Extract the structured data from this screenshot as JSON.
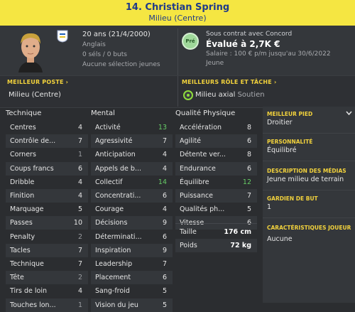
{
  "header": {
    "title": "14. Christian Spring",
    "subtitle": "Milieu (Centre)"
  },
  "player": {
    "age_birth": "20 ans (21/4/2000)",
    "nationality": "Anglais",
    "caps_goals": "0 séls / 0 buts",
    "youth_selection": "Aucune sélection jeunes"
  },
  "contract": {
    "club_text": "Sous contrat avec Concord",
    "value": "Évalué à 2,7K €",
    "salary": "Salaire : 100 € p/m jusqu'au 30/6/2022",
    "status": "Jeune",
    "badge": "Pré"
  },
  "best_position": {
    "label": "MEILLEUR POSTE",
    "value": "Milieu (Centre)"
  },
  "best_role": {
    "label": "MEILLEURS RÔLE ET TÂCHE",
    "role": "Milieu axial",
    "duty": "Soutien"
  },
  "columns": {
    "technique": "Technique",
    "mental": "Mental",
    "physical": "Qualité Physique"
  },
  "technique": [
    {
      "name": "Centres",
      "value": "4"
    },
    {
      "name": "Contrôle de...",
      "value": "7"
    },
    {
      "name": "Corners",
      "value": "1"
    },
    {
      "name": "Coups francs",
      "value": "6"
    },
    {
      "name": "Dribble",
      "value": "4"
    },
    {
      "name": "Finition",
      "value": "4"
    },
    {
      "name": "Marquage",
      "value": "5"
    },
    {
      "name": "Passes",
      "value": "10"
    },
    {
      "name": "Penalty",
      "value": "2"
    },
    {
      "name": "Tacles",
      "value": "7"
    },
    {
      "name": "Technique",
      "value": "7"
    },
    {
      "name": "Tête",
      "value": "2"
    },
    {
      "name": "Tirs de loin",
      "value": "4"
    },
    {
      "name": "Touches lon...",
      "value": "1"
    }
  ],
  "mental": [
    {
      "name": "Activité",
      "value": "13"
    },
    {
      "name": "Agressivité",
      "value": "7"
    },
    {
      "name": "Anticipation",
      "value": "4"
    },
    {
      "name": "Appels de b...",
      "value": "4"
    },
    {
      "name": "Collectif",
      "value": "14"
    },
    {
      "name": "Concentrati...",
      "value": "6"
    },
    {
      "name": "Courage",
      "value": "4"
    },
    {
      "name": "Décisions",
      "value": "9"
    },
    {
      "name": "Déterminati...",
      "value": "6"
    },
    {
      "name": "Inspiration",
      "value": "9"
    },
    {
      "name": "Leadership",
      "value": "7"
    },
    {
      "name": "Placement",
      "value": "6"
    },
    {
      "name": "Sang-froid",
      "value": "5"
    },
    {
      "name": "Vision du jeu",
      "value": "5"
    }
  ],
  "physical": [
    {
      "name": "Accélération",
      "value": "8"
    },
    {
      "name": "Agilité",
      "value": "6"
    },
    {
      "name": "Détente ver...",
      "value": "8"
    },
    {
      "name": "Endurance",
      "value": "6"
    },
    {
      "name": "Équilibre",
      "value": "12"
    },
    {
      "name": "Puissance",
      "value": "7"
    },
    {
      "name": "Qualités ph...",
      "value": "5"
    },
    {
      "name": "Vitesse",
      "value": "6"
    }
  ],
  "measures": [
    {
      "name": "Taille",
      "value": "176 cm"
    },
    {
      "name": "Poids",
      "value": "72 kg"
    }
  ],
  "right": {
    "foot_label": "MEILLEUR PIED",
    "foot": "Droitier",
    "personality_label": "PERSONNALITÉ",
    "personality": "Équilibré",
    "media_label": "DESCRIPTION DES MÉDIAS",
    "media": "Jeune milieu de terrain",
    "gk_label": "GARDIEN DE BUT",
    "gk": "1",
    "traits_label": "CARACTÉRISTIQUES JOUEUR",
    "traits": "Aucune"
  },
  "colors": {
    "header_bg": "#f5e642",
    "header_text": "#1f3a8a",
    "accent": "#f2d23c",
    "high_value": "#66cc66"
  }
}
